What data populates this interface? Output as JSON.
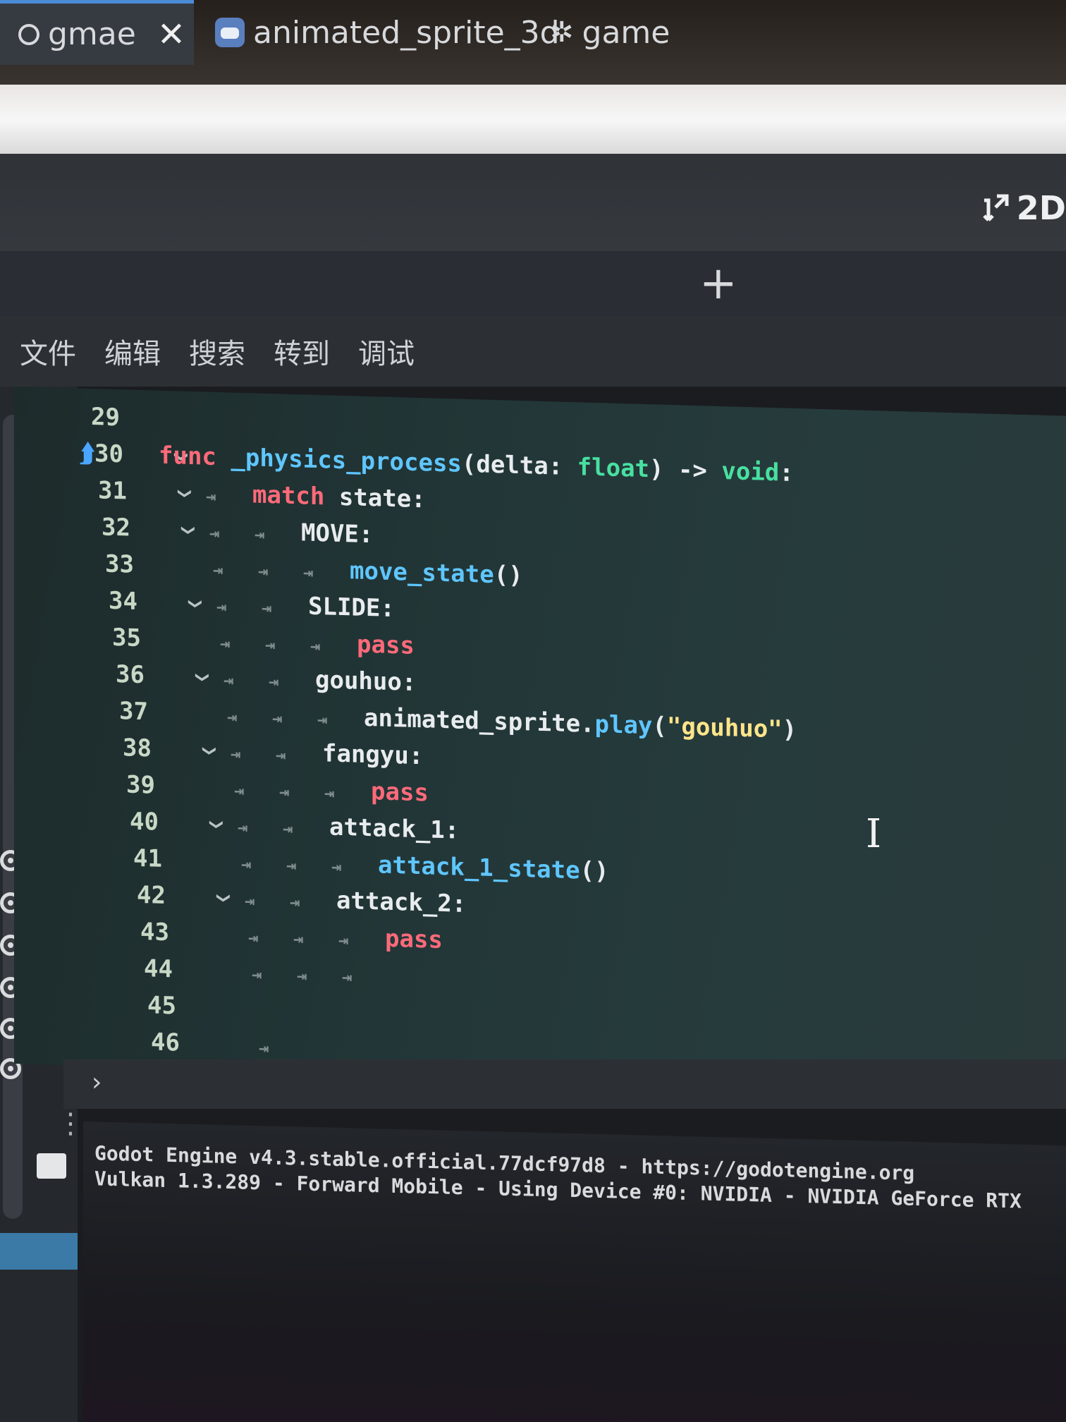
{
  "toolbar": {
    "mode_label": "2D"
  },
  "tabs": [
    {
      "label": "gmae",
      "close": "✕"
    },
    {
      "label": "animated_sprite_3d"
    },
    {
      "label": "game"
    }
  ],
  "tab_add": "+",
  "menu": [
    "文件",
    "编辑",
    "搜索",
    "转到",
    "调试"
  ],
  "code_lines": [
    {
      "n": "29",
      "parts": []
    },
    {
      "n": "30",
      "parts": [
        [
          "kw",
          "func"
        ],
        [
          "pl",
          " "
        ],
        [
          "fn",
          "_physics_process"
        ],
        [
          "pl",
          "(delta: "
        ],
        [
          "ty",
          "float"
        ],
        [
          "pl",
          ") -> "
        ],
        [
          "ty",
          "void"
        ],
        [
          "pl",
          ":"
        ]
      ]
    },
    {
      "n": "31",
      "parts": [
        [
          "kw",
          "match"
        ],
        [
          "pl",
          " state:"
        ]
      ]
    },
    {
      "n": "32",
      "parts": [
        [
          "pl",
          "MOVE:"
        ]
      ]
    },
    {
      "n": "33",
      "parts": [
        [
          "fn",
          "move_state"
        ],
        [
          "pl",
          "()"
        ]
      ]
    },
    {
      "n": "34",
      "parts": [
        [
          "pl",
          "SLIDE:"
        ]
      ]
    },
    {
      "n": "35",
      "parts": [
        [
          "kw",
          "pass"
        ]
      ]
    },
    {
      "n": "36",
      "parts": [
        [
          "pl",
          "gouhuo:"
        ]
      ]
    },
    {
      "n": "37",
      "parts": [
        [
          "pl",
          "animated_sprite."
        ],
        [
          "fn",
          "play"
        ],
        [
          "pl",
          "("
        ],
        [
          "st",
          "\"gouhuo\""
        ],
        [
          "pl",
          ")"
        ]
      ]
    },
    {
      "n": "38",
      "parts": [
        [
          "pl",
          "fangyu:"
        ]
      ]
    },
    {
      "n": "39",
      "parts": [
        [
          "kw",
          "pass"
        ]
      ]
    },
    {
      "n": "40",
      "parts": [
        [
          "pl",
          "attack_1:"
        ]
      ]
    },
    {
      "n": "41",
      "parts": [
        [
          "fn",
          "attack_1_state"
        ],
        [
          "pl",
          "()"
        ]
      ]
    },
    {
      "n": "42",
      "parts": [
        [
          "pl",
          "attack_2:"
        ]
      ]
    },
    {
      "n": "43",
      "parts": [
        [
          "kw",
          "pass"
        ]
      ]
    },
    {
      "n": "44",
      "parts": []
    },
    {
      "n": "45",
      "parts": []
    },
    {
      "n": "46",
      "parts": []
    }
  ],
  "output": [
    "Godot Engine v4.3.stable.official.77dcf97d8 - https://godotengine.org",
    "Vulkan 1.3.289 - Forward Mobile - Using Device #0: NVIDIA - NVIDIA GeForce RTX"
  ]
}
